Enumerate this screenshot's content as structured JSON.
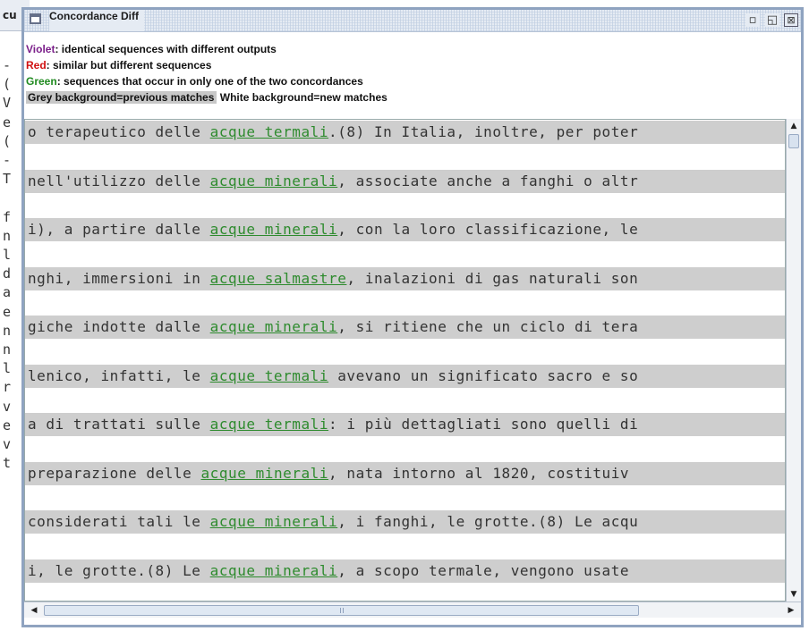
{
  "background_window": {
    "title_fragment": "cu",
    "margin_lines": [
      "-",
      "(",
      "V",
      "e",
      "(",
      "-",
      "T",
      "",
      "f",
      "n",
      "l",
      "d",
      "a",
      "e",
      "n",
      "n",
      "l",
      "r",
      "v",
      "e",
      "v",
      "t"
    ]
  },
  "frame": {
    "title": "Concordance Diff",
    "buttons": {
      "iconify": "▫",
      "maximize": "◱",
      "close": "⊠"
    }
  },
  "legend": {
    "violet_key": "Violet",
    "violet_text": ": identical sequences with different outputs",
    "red_key": "Red",
    "red_text": ": similar but different sequences",
    "green_key": "Green",
    "green_text": ": sequences that occur in only one of the two concordances",
    "grey_label": "Grey background=previous matches",
    "white_label": "White background=new matches",
    "colors": {
      "violet": "#7b1f8a",
      "red": "#d01010",
      "green": "#1f8a1f",
      "match": "#2e8b2e"
    }
  },
  "concordance": {
    "rows": [
      {
        "left": "o terapeutico delle ",
        "match": "acque termali",
        "right": ".(8) In Italia, inoltre, per poter",
        "grey": true
      },
      {
        "left": "nell'utilizzo delle ",
        "match": "acque minerali",
        "right": ", associate anche a fanghi o altr",
        "grey": true
      },
      {
        "left": "i), a partire dalle ",
        "match": "acque minerali",
        "right": ", con la loro classificazione, le",
        "grey": true
      },
      {
        "left": "nghi, immersioni in ",
        "match": "acque salmastre",
        "right": ", inalazioni di gas naturali son",
        "grey": true
      },
      {
        "left": "giche indotte dalle ",
        "match": "acque minerali",
        "right": ", si ritiene che un ciclo di tera",
        "grey": true
      },
      {
        "left": "lenico, infatti, le ",
        "match": "acque termali",
        "right": " avevano un significato sacro e so",
        "grey": true
      },
      {
        "left": "a di trattati sulle ",
        "match": "acque termali",
        "right": ": i più dettagliati sono quelli di",
        "grey": true
      },
      {
        "left": " preparazione delle ",
        "match": "acque minerali",
        "right": ", nata intorno al 1820, costituiv",
        "grey": true
      },
      {
        "left": "considerati tali le ",
        "match": "acque minerali",
        "right": ", i fanghi, le grotte.(8) Le acqu",
        "grey": true
      },
      {
        "left": "i, le grotte.(8) Le ",
        "match": "acque minerali",
        "right": ", a scopo termale, vengono usate",
        "grey": true
      }
    ]
  },
  "scrollbars": {
    "up": "▲",
    "down": "▼",
    "left": "◀",
    "right": "▶"
  }
}
